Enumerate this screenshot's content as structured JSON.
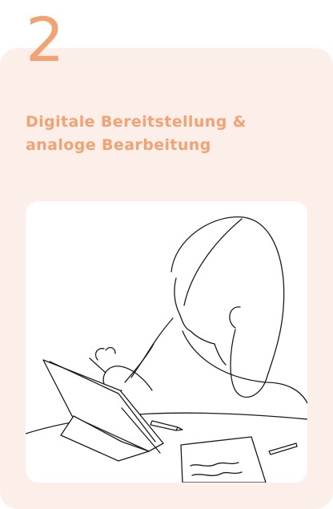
{
  "step": {
    "number": "2"
  },
  "card": {
    "title_line_1": "Digitale Bereitstellung &",
    "title_line_2": "analoge Bearbeitung"
  },
  "colors": {
    "accent": "#f3a271",
    "card_background": "#fcefea"
  },
  "illustration": {
    "icon": "girl-drawing-on-tablet-illustration"
  }
}
